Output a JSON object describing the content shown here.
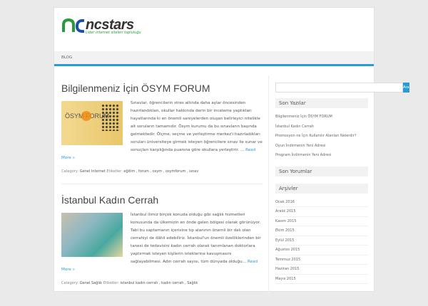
{
  "site": {
    "logo_text": "ncstars",
    "tagline": "Lider internet siteleri topluluğu"
  },
  "nav": {
    "items": [
      {
        "label": "BLOG"
      }
    ]
  },
  "posts": [
    {
      "title": "Bilgilenmeniz İçin ÖSYM FORUM",
      "thumb_text": "ÖSYM FORUM",
      "excerpt": "Sınavlar, öğrencilerin stres altında daha aylar öncesinden hazırlandıkları, okullar hakkında derin bir inceleme yaptıkları hayatlarında ki en önemli saniyelerden oluşan belirleyici nitelikle ait soruların tamamıdır. Ösym kurumu da bu sınavların başında gelmektedir. Ölçme, seçme ve yerleştirme merkez'i hazırladıkları soruları üniversiteye girmek isteyen öğrencilere sınav ile sunar ve sonuçları karşılığında puanına göre okullara yerleştirir. …",
      "read_more": "Read More »",
      "category_label": "Category:",
      "categories": "Genel  Internet",
      "tags_label": "Etiketler:",
      "tags": "eğitim , forum , osym , osymforum , sınav"
    },
    {
      "title": "İstanbul Kadın Cerrah",
      "excerpt": "İstanbul ilimiz birçok konuda olduğu gibi sağlık hizmetleri konusunda da ülkemizin en önde gelen bölgesi olarak görünüyor. Tabi bu saptamanın içerisine tıp alanının önemli bir dalı olan cerrahiyi de dâhil edebiliriz. İstanbul'un önemli özelliklerinden bir tanesi de tedavisini kadın cerrah olarak tanımlanan doktorlara yaptırmak isteyen kişilerin isteklerine kavuşmasını sağlayabilmesi. Adın cerrah sayısı, tüm dünyada olduğu…",
      "read_more": "Read More »",
      "category_label": "Category:",
      "categories": "Genel  Sağlık",
      "tags_label": "Etiketler:",
      "tags": "istanbul kadın cerrah , kadın cerrah , Sağlık"
    }
  ],
  "sidebar": {
    "search_button": "Ara",
    "recent_title": "Son Yazılar",
    "recent": [
      "Bilgilenmeniz İçin ÖSYM FORUM",
      "İstanbul Kadın Cerrah",
      "Promosyon ne İçin Kullanılır Alanları Nelerdir?",
      "Oyun İndirmenin Yeni Adresi",
      "Program İndirmenin Yeni Adresi"
    ],
    "comments_title": "Son Yorumlar",
    "archives_title": "Arşivler",
    "archives": [
      "Ocak 2016",
      "Aralık 2015",
      "Kasım 2015",
      "Ekim 2015",
      "Eylül 2015",
      "Ağustos 2015",
      "Temmuz 2015",
      "Haziran 2015",
      "Mayıs 2015"
    ]
  },
  "colors": {
    "accent": "#2b9bd6",
    "logo_green": "#2a9a3a"
  }
}
